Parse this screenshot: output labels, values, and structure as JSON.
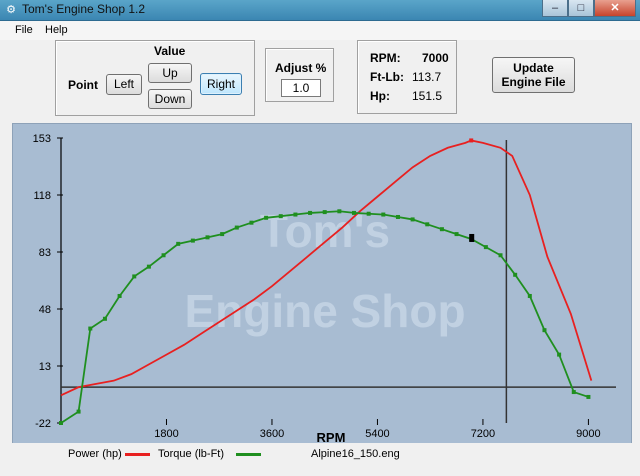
{
  "window": {
    "title": "Tom's Engine Shop 1.2"
  },
  "menu": {
    "file": "File",
    "help": "Help"
  },
  "controls": {
    "value_label": "Value",
    "point_label": "Point",
    "left": "Left",
    "up": "Up",
    "down": "Down",
    "right": "Right",
    "adjust_label": "Adjust %",
    "adjust_value": "1.0",
    "update_line1": "Update",
    "update_line2": "Engine File"
  },
  "readout": {
    "rpm_label": "RPM:",
    "rpm_value": "7000",
    "ftlb_label": "Ft-Lb:",
    "ftlb_value": "113.7",
    "hp_label": "Hp:",
    "hp_value": "151.5"
  },
  "watermark": {
    "line1": "Tom's",
    "line2": "Engine Shop"
  },
  "legend": {
    "power": "Power (hp)",
    "power_color": "#e82020",
    "torque": "Torque (lb-Ft)",
    "torque_color": "#1f8f1f",
    "file": "Alpine16_150.eng"
  },
  "chart_data": {
    "type": "line",
    "xlabel": "RPM",
    "ylabel": "",
    "x_ticks": [
      1800,
      3600,
      5400,
      7200,
      9000
    ],
    "y_ticks": [
      -22,
      13,
      48,
      83,
      118,
      153
    ],
    "xlim": [
      0,
      9300
    ],
    "ylim": [
      -22,
      153
    ],
    "cursor_rpm": 7600,
    "series": [
      {
        "name": "Power (hp)",
        "color": "#e82020",
        "x": [
          0,
          300,
          600,
          900,
          1200,
          1500,
          1800,
          2100,
          2400,
          2700,
          3000,
          3300,
          3600,
          3900,
          4200,
          4500,
          4800,
          5100,
          5400,
          5700,
          6000,
          6300,
          6600,
          6900,
          7000,
          7200,
          7500,
          7700,
          8000,
          8300,
          8700,
          9050
        ],
        "y": [
          -5,
          0,
          2,
          4,
          8,
          14,
          20,
          26,
          33,
          40,
          47,
          54,
          62,
          71,
          80,
          89,
          98,
          108,
          117,
          126,
          135,
          142,
          147,
          150,
          151.5,
          150,
          147,
          142,
          118,
          80,
          45,
          4
        ]
      },
      {
        "name": "Torque (lb-Ft)",
        "color": "#1f8f1f",
        "x": [
          0,
          300,
          500,
          750,
          1000,
          1250,
          1500,
          1750,
          2000,
          2250,
          2500,
          2750,
          3000,
          3250,
          3500,
          3750,
          4000,
          4250,
          4500,
          4750,
          5000,
          5250,
          5500,
          5750,
          6000,
          6250,
          6500,
          6750,
          7000,
          7250,
          7500,
          7750,
          8000,
          8250,
          8500,
          8750,
          9000
        ],
        "y": [
          -22,
          -15,
          36,
          42,
          56,
          68,
          74,
          81,
          88,
          90,
          92,
          94,
          98,
          101,
          104,
          105,
          106,
          107,
          107.5,
          108,
          107,
          106.5,
          106,
          104.5,
          103,
          100,
          97,
          94,
          91,
          86,
          81,
          69,
          56,
          35,
          20,
          -3,
          -6
        ]
      }
    ]
  }
}
